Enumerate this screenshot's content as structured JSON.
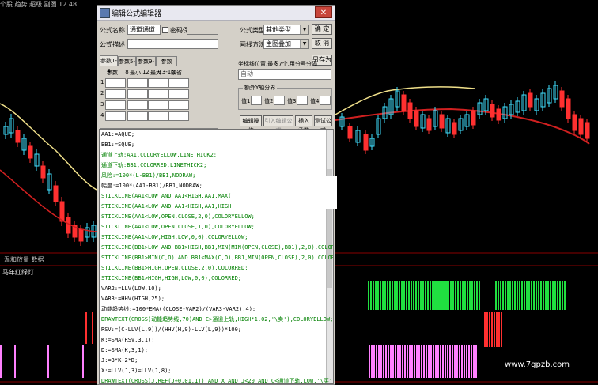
{
  "chart_area": {
    "top_info": "个股  趋势  超级 副图  12.48",
    "sub_chart_label": "温和放量 数据",
    "indicator_label": "马年红绿灯",
    "watermark": "www.7gpzb.com"
  },
  "dialog": {
    "title": "编辑公式编辑器",
    "close_symbol": "✕",
    "formula_name_label": "公式名称",
    "formula_name_value": "通道通道",
    "password_label": "密码保护",
    "formula_desc_label": "公式描述",
    "formula_desc_value": "",
    "formula_type_label": "公式类型",
    "formula_type_value": "其他类型",
    "draw_method_label": "画线方法",
    "draw_method_value": "主图叠加",
    "ok_button": "确 定",
    "cancel_button": "取 消",
    "save_as_button": "另存为",
    "tabs": [
      "参数1-4",
      "参数5-8",
      "参数9-12",
      "参数13-16"
    ],
    "param_headers": [
      "参数",
      "最小",
      "最大",
      "缺省"
    ],
    "param_rows": [
      "1",
      "2",
      "3",
      "4"
    ],
    "coord_label": "坐标线位置,最多7个,用分号分隔",
    "coord_value": "自动",
    "y_axis_group_label": "额外Y轴分界",
    "y_axis_values": [
      "值1",
      "值2",
      "值3",
      "值4"
    ],
    "edit_ops_button": "编辑操作",
    "import_button": "引入编辑公式",
    "insert_func_button": "插入函数",
    "test_button": "测试公式"
  },
  "editor_lines": [
    {
      "text": "AA1:=AQUE;",
      "color": "#000000"
    },
    {
      "text": "BB1:=SQUE;",
      "color": "#000000"
    },
    {
      "text": "通道上轨:AA1,COLORYELLOW,LINETHICK2;",
      "color": "#008000"
    },
    {
      "text": "通道下轨:BB1,COLORRED,LINETHICK2;",
      "color": "#008000"
    },
    {
      "text": "风险:=100*(L-BB1)/BB1,NODRAW;",
      "color": "#008000"
    },
    {
      "text": "幅度:=100*(AA1-BB1)/BB1,NODRAW;",
      "color": "#000000"
    },
    {
      "text": "STICKLINE(AA1<LOW AND AA1<HIGH,AA1,MAX(AA1,MAX(OPEN,",
      "color": "#008000"
    },
    {
      "text": "STICKLINE(AA1<LOW AND AA1<HIGH,AA1,HIGH,0,0),COLOR",
      "color": "#008000"
    },
    {
      "text": "STICKLINE(AA1<LOW,OPEN,CLOSE,2,0),COLORYELLOW;",
      "color": "#008000"
    },
    {
      "text": "STICKLINE(AA1<LOW,OPEN,CLOSE,1,0),COLORYELLOW;",
      "color": "#008000"
    },
    {
      "text": "STICKLINE(AA1<LOW,HIGH,LOW,0,0),COLORYELLOW;",
      "color": "#008000"
    },
    {
      "text": "STICKLINE(BB1>LOW AND BB1>HIGH,BB1,MIN(MIN(OPEN,CLOSE),BB1),2,0),COLORRED;",
      "color": "#008000"
    },
    {
      "text": "STICKLINE(BB1>MIN(C,O) AND BB1<MAX(C,O),BB1,MIN(OPEN,CLOSE),2,0),COLORRED;",
      "color": "#008000"
    },
    {
      "text": "STICKLINE(BB1>HIGH,OPEN,CLOSE,2,0),COLORRED;",
      "color": "#008000"
    },
    {
      "text": "STICKLINE(BB1>HIGH,HIGH,LOW,0,0),COLORRED;",
      "color": "#008000"
    },
    {
      "text": "VAR2:=LLV(LOW,10);",
      "color": "#000000"
    },
    {
      "text": "VAR3:=HHV(HIGH,25);",
      "color": "#000000"
    },
    {
      "text": "动能趋势线:=100*EMA((CLOSE-VAR2)/(VAR3-VAR2),4);",
      "color": "#000000"
    },
    {
      "text": "DRAWTEXT(CROSS(动能趋势线,70)AND C>通道上轨,HIGH*1.02,'\\卖'),COLORYELLOW;",
      "color": "#008000"
    },
    {
      "text": "RSV:=(C-LLV(L,9))/(HHV(H,9)-LLV(L,9))*100;",
      "color": "#000000"
    },
    {
      "text": "K:=SMA(RSV,3,1);",
      "color": "#000000"
    },
    {
      "text": "D:=SMA(K,3,1);",
      "color": "#000000"
    },
    {
      "text": "J:=3*K-2*D;",
      "color": "#000000"
    },
    {
      "text": "X:=LLV(J,3)=LLV(J,8);",
      "color": "#000000"
    },
    {
      "text": "DRAWTEXT(CROSS(J,REF(J+0.01,1)) AND X AND J<20 AND C<通道下轨,LOW,'\\买'),COLORRED;",
      "color": "#008000"
    }
  ],
  "colors": {
    "up_candle": "#40e0ff",
    "down_candle": "#ff3030",
    "yellow_line": "#f0e08a",
    "red_line": "#d02020",
    "green_bar": "#20e040",
    "pink_bar": "#ff80ff"
  }
}
